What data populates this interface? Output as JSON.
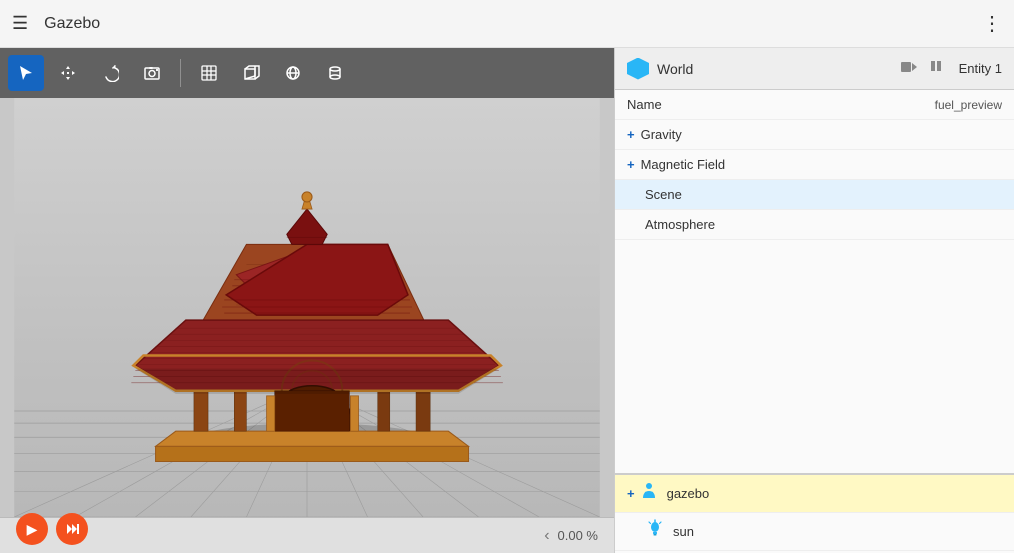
{
  "titlebar": {
    "title": "Gazebo",
    "menu_icon": "☰",
    "more_icon": "⋮"
  },
  "toolbar": {
    "buttons": [
      {
        "name": "select-tool",
        "icon": "↖",
        "active": true,
        "label": "Select"
      },
      {
        "name": "move-tool",
        "icon": "✛",
        "active": false,
        "label": "Move"
      },
      {
        "name": "rotate-tool",
        "icon": "↻",
        "active": false,
        "label": "Rotate"
      },
      {
        "name": "screenshot-tool",
        "icon": "📷",
        "active": false,
        "label": "Screenshot"
      },
      {
        "name": "grid-tool",
        "icon": "⊞",
        "active": false,
        "label": "Grid"
      },
      {
        "name": "box-tool",
        "icon": "□",
        "active": false,
        "label": "Box"
      },
      {
        "name": "sphere-tool",
        "icon": "○",
        "active": false,
        "label": "Sphere"
      },
      {
        "name": "cylinder-tool",
        "icon": "⬜",
        "active": false,
        "label": "Cylinder"
      }
    ]
  },
  "panel": {
    "world_label": "World",
    "record_icon": "⬜",
    "pause_icon": "⏸",
    "entity_label": "Entity 1",
    "properties": [
      {
        "key": "Name",
        "value": "fuel_preview",
        "expandable": false
      },
      {
        "key": "Gravity",
        "value": "",
        "expandable": true
      },
      {
        "key": "Magnetic Field",
        "value": "",
        "expandable": true
      },
      {
        "key": "Scene",
        "value": "",
        "expandable": false,
        "selected": true
      },
      {
        "key": "Atmosphere",
        "value": "",
        "expandable": false
      }
    ],
    "entities": [
      {
        "name": "gazebo",
        "icon": "person",
        "expandable": true
      },
      {
        "name": "sun",
        "icon": "light",
        "expandable": false
      }
    ]
  },
  "statusbar": {
    "progress": "0.00 %",
    "play_label": "▶",
    "fwd_label": "⏭"
  },
  "colors": {
    "accent_blue": "#1565c0",
    "panel_bg": "#fafafa",
    "toolbar_bg": "#616161",
    "titlebar_bg": "#f5f5f5",
    "scene_bg": "#c8c8c8",
    "play_btn": "#f4511e",
    "entity_selected": "#fff9c4"
  }
}
